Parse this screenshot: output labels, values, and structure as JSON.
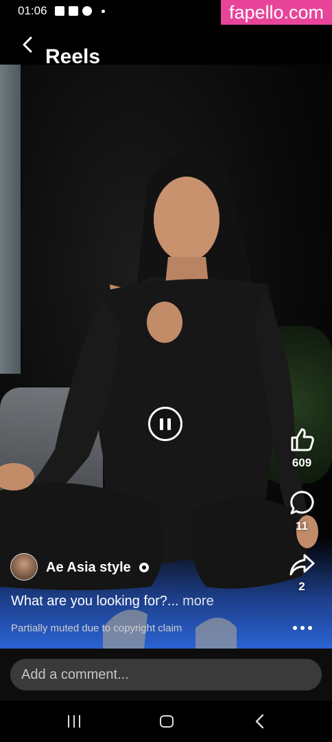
{
  "status_bar": {
    "time": "01:06"
  },
  "watermark": "fapello.com",
  "header": {
    "title": "Reels"
  },
  "actions": {
    "likes": "609",
    "comments": "11",
    "shares": "2"
  },
  "post": {
    "author": "Ae Asia style",
    "caption": "What are you looking for?...",
    "more_label": " more",
    "muted_notice": "Partially muted due to copyright claim"
  },
  "comment": {
    "placeholder": "Add a comment..."
  },
  "colors": {
    "watermark": "#e8459a",
    "comment_box": "#3a3a3a",
    "background": "#000000"
  },
  "icons": [
    "image-icon",
    "folder-icon",
    "facebook-icon",
    "back-icon",
    "pause-icon",
    "like-icon",
    "comment-icon",
    "share-icon",
    "verified-icon",
    "more-icon"
  ]
}
